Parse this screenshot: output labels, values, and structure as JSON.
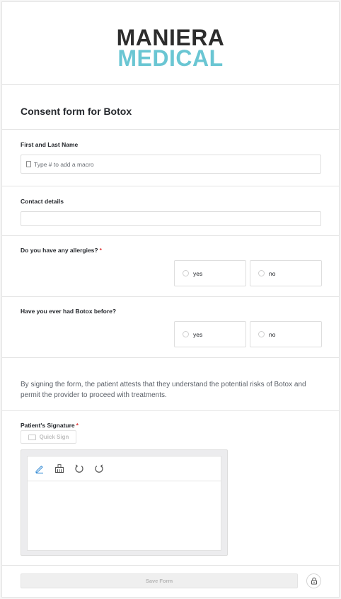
{
  "brand": {
    "line1": "MANIERA",
    "line2": "MEDICAL",
    "color_dark": "#2d2d2d",
    "color_accent": "#6ac6d3"
  },
  "form": {
    "title": "Consent form for Botox"
  },
  "fields": {
    "name": {
      "label": "First and Last Name",
      "placeholder": "Type # to add a macro",
      "value": ""
    },
    "contact": {
      "label": "Contact details",
      "value": ""
    },
    "allergies": {
      "label": "Do you have any allergies?",
      "required": "*",
      "options": [
        "yes",
        "no"
      ]
    },
    "botox_before": {
      "label": "Have you ever had Botox before?",
      "options": [
        "yes",
        "no"
      ]
    }
  },
  "attestation": "By signing the form, the patient attests that they understand the potential risks of Botox and permit the provider to proceed with treatments.",
  "signature": {
    "label": "Patient's Signature",
    "required": "*",
    "quick_sign": "Quick Sign",
    "tools": [
      "pen-icon",
      "eraser-icon",
      "undo-icon",
      "redo-icon"
    ]
  },
  "footer": {
    "save_label": "Save Form",
    "lock_icon": "lock-icon"
  },
  "colors": {
    "required": "#dd3333",
    "pen_active": "#3b8fd6"
  }
}
